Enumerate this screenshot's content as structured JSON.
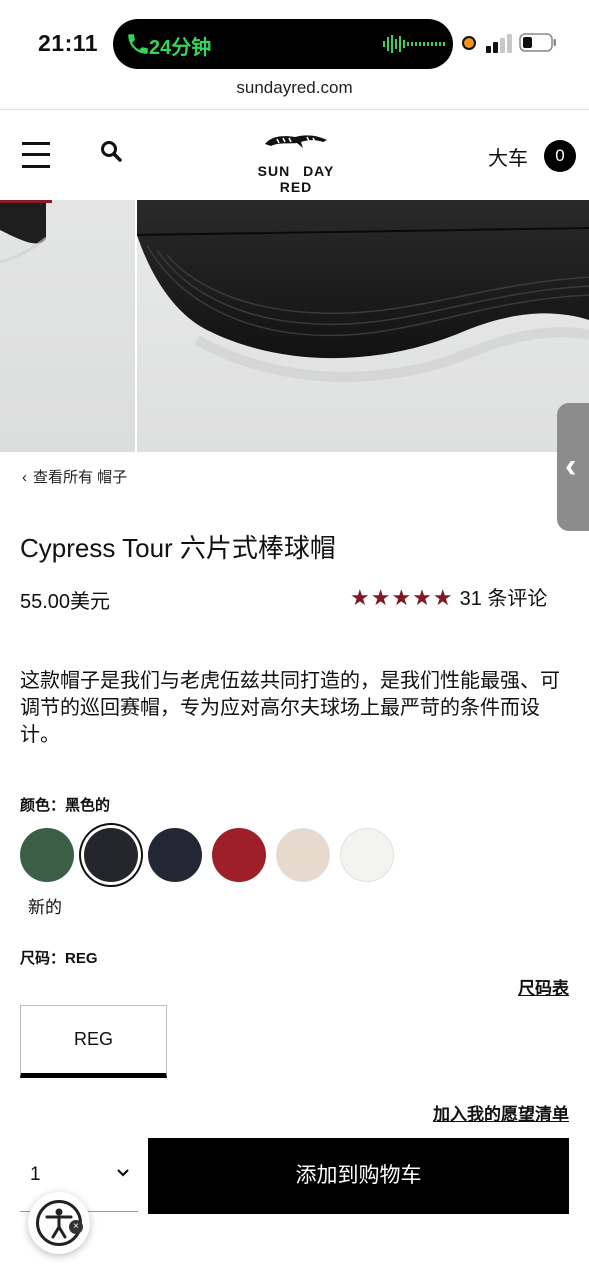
{
  "status_bar": {
    "time": "21:11",
    "call_timer": "24分钟"
  },
  "browser": {
    "url": "sundayred.com"
  },
  "header": {
    "logo_text": "SUN DAY RED",
    "cart_label": "大车",
    "cart_count": "0"
  },
  "breadcrumb": {
    "label": "查看所有 帽子"
  },
  "product": {
    "title": "Cypress Tour 六片式棒球帽",
    "price": "55.00美元",
    "rating_stars": 5,
    "review_count_label": "31 条评论",
    "description": "这款帽子是我们与老虎伍兹共同打造的，是我们性能最强、可调节的巡回赛帽，专为应对高尔夫球场上最严苛的条件而设计。"
  },
  "colors": {
    "label": "颜色：黑色的",
    "swatches": [
      "#3b5e45",
      "#24262b",
      "#222733",
      "#9e1f29",
      "#e7d9cc",
      "#f3f4ef"
    ],
    "selected_index": 1,
    "new_tag": "新的"
  },
  "sizes": {
    "label": "尺码：REG",
    "chart_link": "尺码表",
    "options": [
      "REG"
    ]
  },
  "actions": {
    "wishlist": "加入我的愿望清单",
    "quantity": "1",
    "add_to_cart": "添加到购物车"
  },
  "accent_colors": {
    "star": "#7e1a25",
    "call_green": "#35d55a"
  }
}
